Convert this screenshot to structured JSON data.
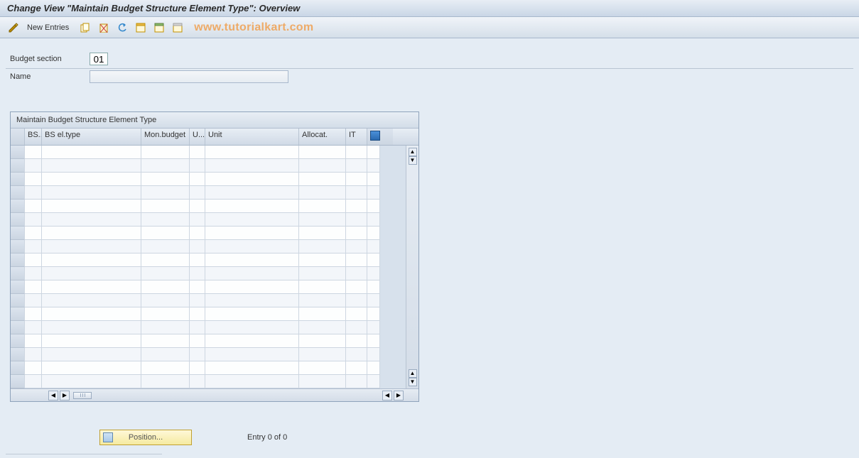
{
  "title": "Change View \"Maintain Budget Structure Element Type\": Overview",
  "toolbar": {
    "newEntries": "New Entries"
  },
  "watermark": "www.tutorialkart.com",
  "form": {
    "budgetSectionLabel": "Budget section",
    "budgetSectionValue": "01",
    "nameLabel": "Name",
    "nameValue": ""
  },
  "table": {
    "title": "Maintain Budget Structure Element Type",
    "columns": {
      "bs": "BS...",
      "type": "BS el.type",
      "mon": "Mon.budget",
      "u": "U...",
      "unit": "Unit",
      "alloc": "Allocat.",
      "it": "IT"
    }
  },
  "footer": {
    "positionLabel": "Position...",
    "entryText": "Entry 0 of 0"
  }
}
